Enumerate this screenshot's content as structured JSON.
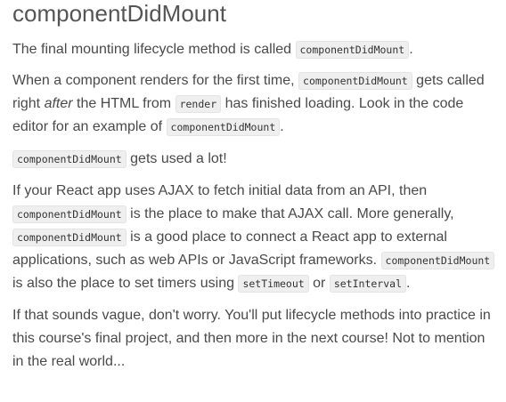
{
  "title": "componentDidMount",
  "para1": {
    "t1": "The final mounting lifecycle method is called ",
    "c1": "componentDidMount",
    "t2": "."
  },
  "para2": {
    "t1": "When a component renders for the first time, ",
    "c1": "componentDidMount",
    "t2": " gets called right ",
    "em": "after",
    "t3": " the HTML from ",
    "c2": "render",
    "t4": " has finished loading. Look in the code editor for an example of ",
    "c3": "componentDidMount",
    "t5": "."
  },
  "para3": {
    "c1": "componentDidMount",
    "t1": " gets used a lot!"
  },
  "para4": {
    "t1": "If your React app uses AJAX to fetch initial data from an API, then ",
    "c1": "componentDidMount",
    "t2": " is the place to make that AJAX call. More generally, ",
    "c2": "componentDidMount",
    "t3": " is a good place to connect a React app to external applications, such as web APIs or JavaScript frameworks. ",
    "c3": "componentDidMount",
    "t4": " is also the place to set timers using ",
    "c4": "setTimeout",
    "t5": " or ",
    "c5": "setInterval",
    "t6": "."
  },
  "para5": {
    "t1": "If that sounds vague, don't worry. You'll put lifecycle methods into practice in this course's final project, and then more in the next course! Not to mention in the real world..."
  }
}
